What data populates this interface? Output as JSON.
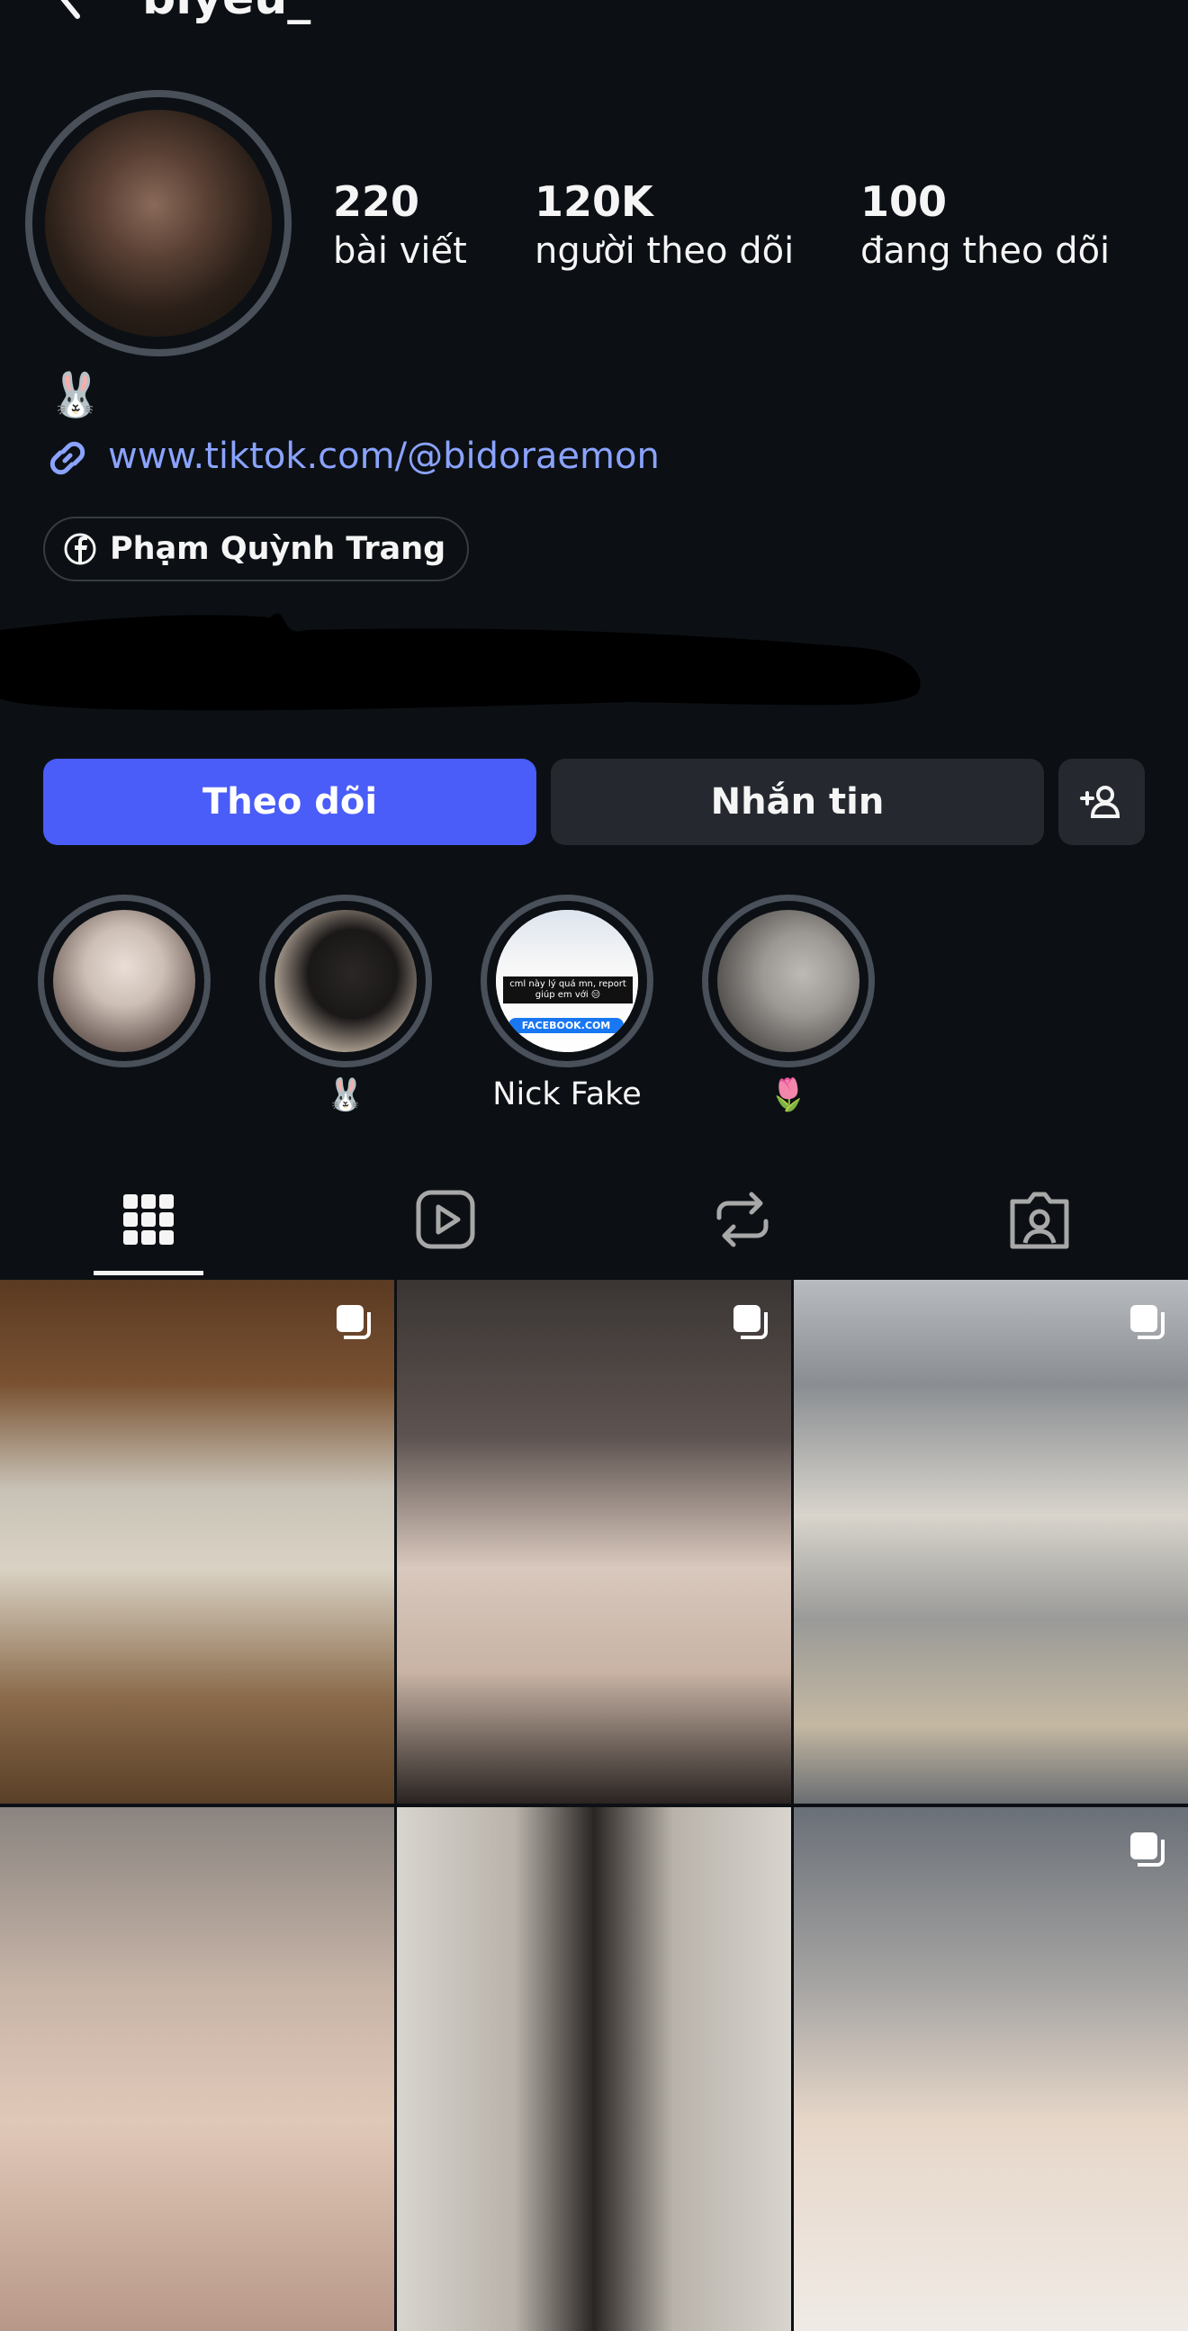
{
  "header": {
    "username": "biyeu_"
  },
  "stats": [
    {
      "value": "220",
      "label": "bài viết"
    },
    {
      "value": "120K",
      "label": "người theo dõi"
    },
    {
      "value": "100",
      "label": "đang theo dõi"
    }
  ],
  "bio": {
    "emoji": "🐰",
    "link": "www.tiktok.com/@bidoraemon",
    "facebook_name": "Phạm Quỳnh Trang"
  },
  "actions": {
    "follow": "Theo dõi",
    "message": "Nhắn tin"
  },
  "highlights": [
    {
      "label": ""
    },
    {
      "label": "🐰"
    },
    {
      "label": "Nick Fake",
      "overlay_caption": "cml này lý quá mn, report giúp em với 😑",
      "overlay_site": "FACEBOOK.COM"
    },
    {
      "label": "🌷"
    }
  ],
  "tabs": [
    "grid-icon",
    "reels-icon",
    "reposts-icon",
    "tagged-icon"
  ],
  "colors": {
    "background": "#0c1014",
    "accent": "#4a5df9",
    "link": "#8aa3ff",
    "button": "#25292f"
  }
}
